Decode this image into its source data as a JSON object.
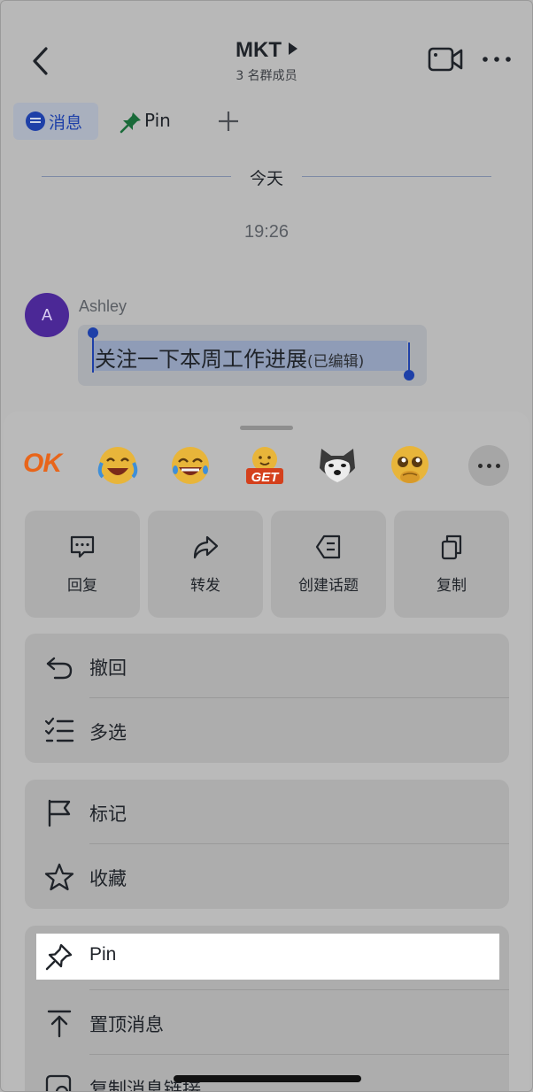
{
  "header": {
    "title": "MKT",
    "subtitle": "3 名群成员"
  },
  "tabs": [
    {
      "label": "消息",
      "icon": "chat-bubble-icon",
      "active": true
    },
    {
      "label": "Pin",
      "icon": "pin-icon",
      "active": false
    }
  ],
  "timeline": {
    "day": "今天",
    "time": "19:26"
  },
  "message": {
    "avatar_initial": "A",
    "sender": "Ashley",
    "text": "关注一下本周工作进展",
    "edited_tag": "(已编辑)"
  },
  "reactions": [
    {
      "name": "ok",
      "text": "OK"
    },
    {
      "name": "laugh-cry-emoji"
    },
    {
      "name": "laughing-emoji"
    },
    {
      "name": "get-emoji",
      "text": "GET"
    },
    {
      "name": "husky-emoji"
    },
    {
      "name": "pleading-emoji"
    }
  ],
  "quick_actions": [
    {
      "label": "回复",
      "icon": "reply-bubble-icon"
    },
    {
      "label": "转发",
      "icon": "forward-arrow-icon"
    },
    {
      "label": "创建话题",
      "icon": "topic-icon"
    },
    {
      "label": "复制",
      "icon": "copy-icon"
    }
  ],
  "menu_groups": [
    [
      {
        "label": "撤回",
        "icon": "undo-icon"
      },
      {
        "label": "多选",
        "icon": "multi-select-icon"
      }
    ],
    [
      {
        "label": "标记",
        "icon": "flag-icon"
      },
      {
        "label": "收藏",
        "icon": "star-icon"
      }
    ],
    [
      {
        "label": "Pin",
        "icon": "pin-icon",
        "highlighted": true
      },
      {
        "label": "置顶消息",
        "icon": "pin-to-top-icon"
      },
      {
        "label": "复制消息链接",
        "icon": "link-icon"
      }
    ]
  ],
  "colors": {
    "accent": "#1e40a8",
    "avatar": "#4b2896",
    "ok_orange": "#e8651a"
  }
}
